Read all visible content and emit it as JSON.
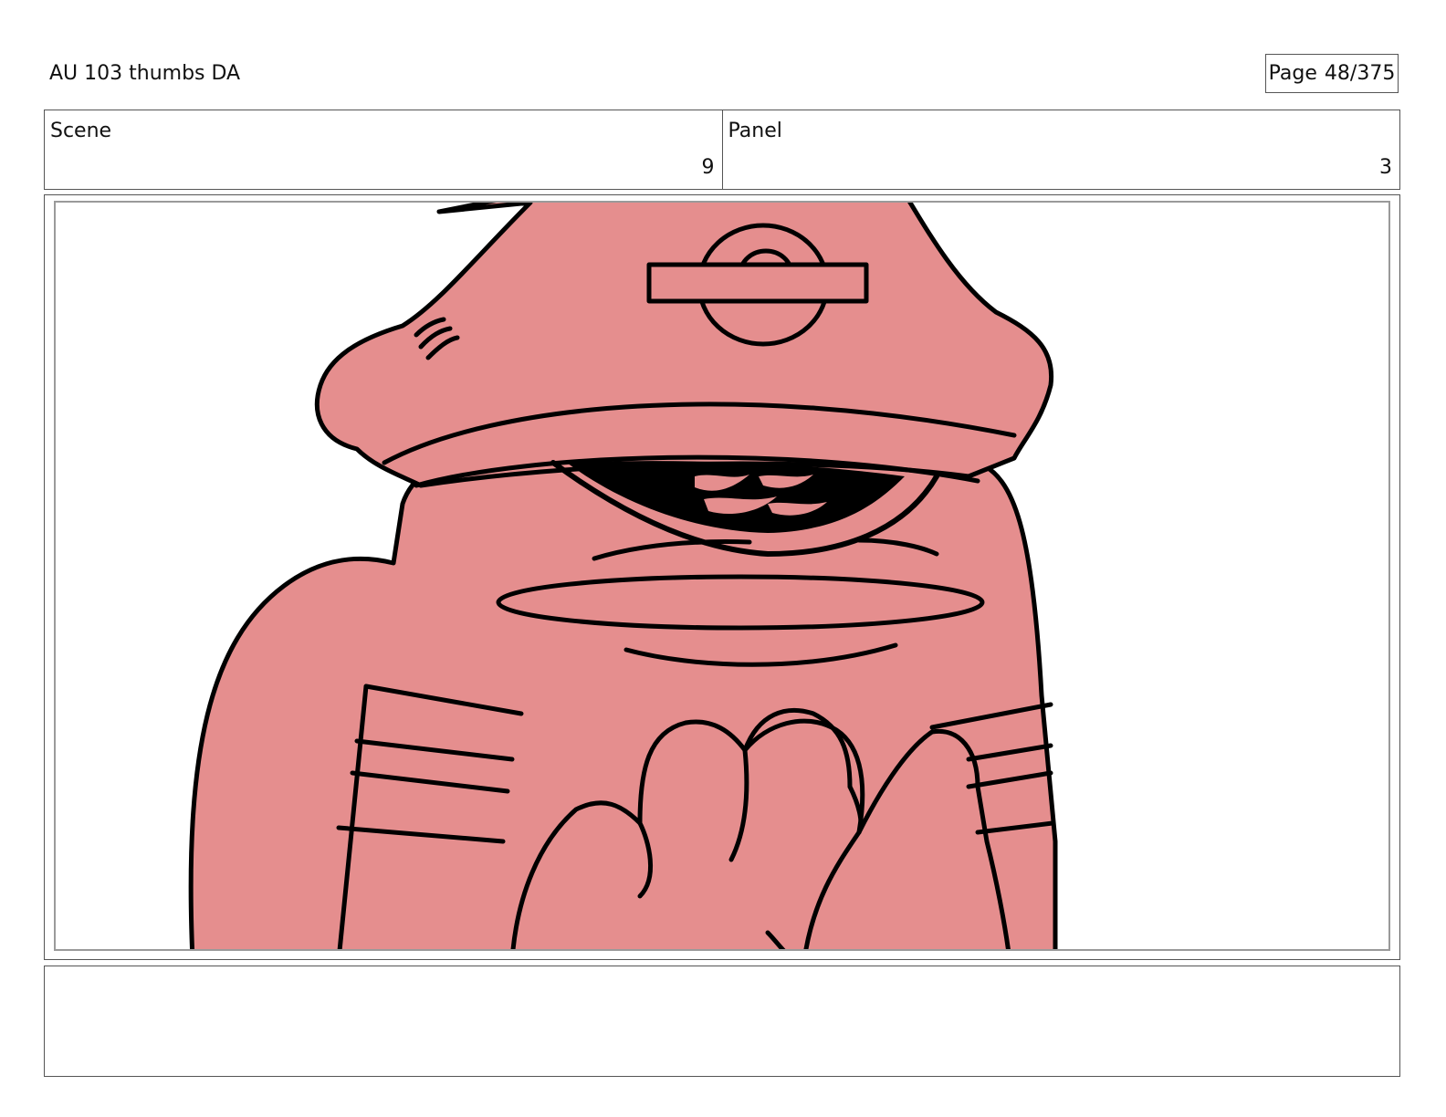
{
  "document": {
    "title": "AU 103 thumbs DA",
    "page_label": "Page",
    "page_value": "48/375"
  },
  "meta": {
    "scene_label": "Scene",
    "scene_value": "9",
    "panel_label": "Panel",
    "panel_value": "3"
  },
  "artwork": {
    "subject": "character-drawing",
    "fill_color": "#e58e8e",
    "line_color": "#000000"
  },
  "notes": {
    "text": ""
  }
}
